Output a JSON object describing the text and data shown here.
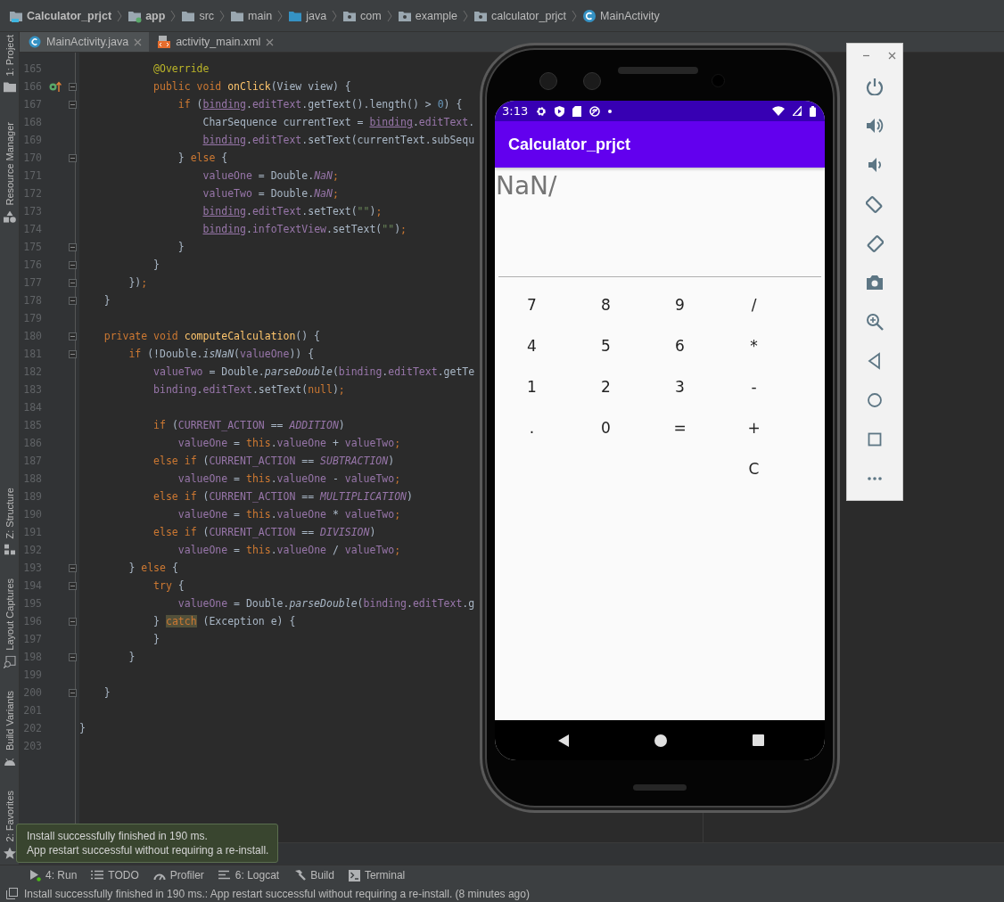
{
  "breadcrumb": [
    {
      "label": "Calculator_prjct",
      "kind": "project"
    },
    {
      "label": "app",
      "kind": "module"
    },
    {
      "label": "src",
      "kind": "folder"
    },
    {
      "label": "main",
      "kind": "folder"
    },
    {
      "label": "java",
      "kind": "source"
    },
    {
      "label": "com",
      "kind": "package"
    },
    {
      "label": "example",
      "kind": "package"
    },
    {
      "label": "calculator_prjct",
      "kind": "package"
    },
    {
      "label": "MainActivity",
      "kind": "class"
    }
  ],
  "tool_strip": {
    "top": [
      {
        "label": "1: Project",
        "kind": "project"
      },
      {
        "label": "Resource Manager",
        "kind": "resource"
      }
    ],
    "bottom": [
      {
        "label": "Z: Structure",
        "kind": "structure"
      },
      {
        "label": "Layout Captures",
        "kind": "captures"
      },
      {
        "label": "Build Variants",
        "kind": "variants"
      },
      {
        "label": "2: Favorites",
        "kind": "favorites"
      }
    ]
  },
  "editor_tabs": [
    {
      "label": "MainActivity.java",
      "kind": "java",
      "selected": true
    },
    {
      "label": "activity_main.xml",
      "kind": "xml",
      "selected": false
    }
  ],
  "editor": {
    "lines": [
      {
        "number": "165",
        "fold": false,
        "override": false,
        "tokens": [
          {
            "kind": "annotation",
            "text": "            @Override"
          }
        ]
      },
      {
        "number": "166",
        "fold": true,
        "override": true,
        "tokens": [
          {
            "kind": "keyword",
            "text": "            public void "
          },
          {
            "kind": "declaration",
            "text": "onClick"
          },
          {
            "kind": "plain",
            "text": "(View view) {"
          }
        ]
      },
      {
        "number": "167",
        "fold": true,
        "override": false,
        "tokens": [
          {
            "kind": "keyword",
            "text": "                if "
          },
          {
            "kind": "plain",
            "text": "("
          },
          {
            "kind": "reference",
            "text": "binding"
          },
          {
            "kind": "plain",
            "text": "."
          },
          {
            "kind": "field",
            "text": "editText"
          },
          {
            "kind": "plain",
            "text": ".getText().length() > "
          },
          {
            "kind": "number",
            "text": "0"
          },
          {
            "kind": "plain",
            "text": ") {"
          }
        ]
      },
      {
        "number": "168",
        "fold": false,
        "override": false,
        "tokens": [
          {
            "kind": "plain",
            "text": "                    CharSequence currentText = "
          },
          {
            "kind": "reference",
            "text": "binding"
          },
          {
            "kind": "plain",
            "text": "."
          },
          {
            "kind": "field",
            "text": "editText"
          },
          {
            "kind": "plain",
            "text": "."
          }
        ]
      },
      {
        "number": "169",
        "fold": false,
        "override": false,
        "tokens": [
          {
            "kind": "reference",
            "text": "                    binding"
          },
          {
            "kind": "plain",
            "text": "."
          },
          {
            "kind": "field",
            "text": "editText"
          },
          {
            "kind": "plain",
            "text": ".setText(currentText.subSequ"
          }
        ]
      },
      {
        "number": "170",
        "fold": true,
        "override": false,
        "tokens": [
          {
            "kind": "plain",
            "text": "                } "
          },
          {
            "kind": "keyword",
            "text": "else "
          },
          {
            "kind": "plain",
            "text": "{"
          }
        ]
      },
      {
        "number": "171",
        "fold": false,
        "override": false,
        "tokens": [
          {
            "kind": "field",
            "text": "                    valueOne"
          },
          {
            "kind": "plain",
            "text": " = Double."
          },
          {
            "kind": "constant",
            "text": "NaN"
          },
          {
            "kind": "keyword",
            "text": ";"
          }
        ]
      },
      {
        "number": "172",
        "fold": false,
        "override": false,
        "tokens": [
          {
            "kind": "field",
            "text": "                    valueTwo"
          },
          {
            "kind": "plain",
            "text": " = Double."
          },
          {
            "kind": "constant",
            "text": "NaN"
          },
          {
            "kind": "keyword",
            "text": ";"
          }
        ]
      },
      {
        "number": "173",
        "fold": false,
        "override": false,
        "tokens": [
          {
            "kind": "reference",
            "text": "                    binding"
          },
          {
            "kind": "plain",
            "text": "."
          },
          {
            "kind": "field",
            "text": "editText"
          },
          {
            "kind": "plain",
            "text": ".setText("
          },
          {
            "kind": "string",
            "text": "\"\""
          },
          {
            "kind": "plain",
            "text": ")"
          },
          {
            "kind": "keyword",
            "text": ";"
          }
        ]
      },
      {
        "number": "174",
        "fold": false,
        "override": false,
        "tokens": [
          {
            "kind": "reference",
            "text": "                    binding"
          },
          {
            "kind": "plain",
            "text": "."
          },
          {
            "kind": "field",
            "text": "infoTextView"
          },
          {
            "kind": "plain",
            "text": ".setText("
          },
          {
            "kind": "string",
            "text": "\"\""
          },
          {
            "kind": "plain",
            "text": ")"
          },
          {
            "kind": "keyword",
            "text": ";"
          }
        ]
      },
      {
        "number": "175",
        "fold": true,
        "override": false,
        "tokens": [
          {
            "kind": "plain",
            "text": "                }"
          }
        ]
      },
      {
        "number": "176",
        "fold": true,
        "override": false,
        "tokens": [
          {
            "kind": "plain",
            "text": "            }"
          }
        ]
      },
      {
        "number": "177",
        "fold": true,
        "override": false,
        "tokens": [
          {
            "kind": "plain",
            "text": "        })"
          },
          {
            "kind": "keyword",
            "text": ";"
          }
        ]
      },
      {
        "number": "178",
        "fold": true,
        "override": false,
        "tokens": [
          {
            "kind": "plain",
            "text": "    }"
          }
        ]
      },
      {
        "number": "179",
        "fold": false,
        "override": false
      },
      {
        "number": "180",
        "fold": true,
        "override": false,
        "tokens": [
          {
            "kind": "keyword",
            "text": "    private void "
          },
          {
            "kind": "declaration",
            "text": "computeCalculation"
          },
          {
            "kind": "plain",
            "text": "() {"
          }
        ]
      },
      {
        "number": "181",
        "fold": true,
        "override": false,
        "tokens": [
          {
            "kind": "keyword",
            "text": "        if "
          },
          {
            "kind": "plain",
            "text": "(!Double."
          },
          {
            "kind": "call",
            "text": "isNaN"
          },
          {
            "kind": "plain",
            "text": "("
          },
          {
            "kind": "field",
            "text": "valueOne"
          },
          {
            "kind": "plain",
            "text": ")) {"
          }
        ]
      },
      {
        "number": "182",
        "fold": false,
        "override": false,
        "tokens": [
          {
            "kind": "field",
            "text": "            valueTwo"
          },
          {
            "kind": "plain",
            "text": " = Double."
          },
          {
            "kind": "call",
            "text": "parseDouble"
          },
          {
            "kind": "plain",
            "text": "("
          },
          {
            "kind": "field",
            "text": "binding"
          },
          {
            "kind": "plain",
            "text": "."
          },
          {
            "kind": "field",
            "text": "editText"
          },
          {
            "kind": "plain",
            "text": ".getTe"
          }
        ]
      },
      {
        "number": "183",
        "fold": false,
        "override": false,
        "tokens": [
          {
            "kind": "field",
            "text": "            binding"
          },
          {
            "kind": "plain",
            "text": "."
          },
          {
            "kind": "field",
            "text": "editText"
          },
          {
            "kind": "plain",
            "text": ".setText("
          },
          {
            "kind": "keyword",
            "text": "null"
          },
          {
            "kind": "plain",
            "text": ")"
          },
          {
            "kind": "keyword",
            "text": ";"
          }
        ]
      },
      {
        "number": "184",
        "fold": false,
        "override": false
      },
      {
        "number": "185",
        "fold": false,
        "override": false,
        "tokens": [
          {
            "kind": "keyword",
            "text": "            if "
          },
          {
            "kind": "plain",
            "text": "("
          },
          {
            "kind": "field",
            "text": "CURRENT_ACTION"
          },
          {
            "kind": "plain",
            "text": " == "
          },
          {
            "kind": "constant",
            "text": "ADDITION"
          },
          {
            "kind": "plain",
            "text": ")"
          }
        ]
      },
      {
        "number": "186",
        "fold": false,
        "override": false,
        "tokens": [
          {
            "kind": "field",
            "text": "                valueOne"
          },
          {
            "kind": "plain",
            "text": " = "
          },
          {
            "kind": "keyword",
            "text": "this"
          },
          {
            "kind": "plain",
            "text": "."
          },
          {
            "kind": "field",
            "text": "valueOne"
          },
          {
            "kind": "plain",
            "text": " + "
          },
          {
            "kind": "field",
            "text": "valueTwo"
          },
          {
            "kind": "keyword",
            "text": ";"
          }
        ]
      },
      {
        "number": "187",
        "fold": false,
        "override": false,
        "tokens": [
          {
            "kind": "keyword",
            "text": "            else if "
          },
          {
            "kind": "plain",
            "text": "("
          },
          {
            "kind": "field",
            "text": "CURRENT_ACTION"
          },
          {
            "kind": "plain",
            "text": " == "
          },
          {
            "kind": "constant",
            "text": "SUBTRACTION"
          },
          {
            "kind": "plain",
            "text": ")"
          }
        ]
      },
      {
        "number": "188",
        "fold": false,
        "override": false,
        "tokens": [
          {
            "kind": "field",
            "text": "                valueOne"
          },
          {
            "kind": "plain",
            "text": " = "
          },
          {
            "kind": "keyword",
            "text": "this"
          },
          {
            "kind": "plain",
            "text": "."
          },
          {
            "kind": "field",
            "text": "valueOne"
          },
          {
            "kind": "plain",
            "text": " - "
          },
          {
            "kind": "field",
            "text": "valueTwo"
          },
          {
            "kind": "keyword",
            "text": ";"
          }
        ]
      },
      {
        "number": "189",
        "fold": false,
        "override": false,
        "tokens": [
          {
            "kind": "keyword",
            "text": "            else if "
          },
          {
            "kind": "plain",
            "text": "("
          },
          {
            "kind": "field",
            "text": "CURRENT_ACTION"
          },
          {
            "kind": "plain",
            "text": " == "
          },
          {
            "kind": "constant",
            "text": "MULTIPLICATION"
          },
          {
            "kind": "plain",
            "text": ")"
          }
        ]
      },
      {
        "number": "190",
        "fold": false,
        "override": false,
        "tokens": [
          {
            "kind": "field",
            "text": "                valueOne"
          },
          {
            "kind": "plain",
            "text": " = "
          },
          {
            "kind": "keyword",
            "text": "this"
          },
          {
            "kind": "plain",
            "text": "."
          },
          {
            "kind": "field",
            "text": "valueOne"
          },
          {
            "kind": "plain",
            "text": " * "
          },
          {
            "kind": "field",
            "text": "valueTwo"
          },
          {
            "kind": "keyword",
            "text": ";"
          }
        ]
      },
      {
        "number": "191",
        "fold": false,
        "override": false,
        "tokens": [
          {
            "kind": "keyword",
            "text": "            else if "
          },
          {
            "kind": "plain",
            "text": "("
          },
          {
            "kind": "field",
            "text": "CURRENT_ACTION"
          },
          {
            "kind": "plain",
            "text": " == "
          },
          {
            "kind": "constant",
            "text": "DIVISION"
          },
          {
            "kind": "plain",
            "text": ")"
          }
        ]
      },
      {
        "number": "192",
        "fold": false,
        "override": false,
        "tokens": [
          {
            "kind": "field",
            "text": "                valueOne"
          },
          {
            "kind": "plain",
            "text": " = "
          },
          {
            "kind": "keyword",
            "text": "this"
          },
          {
            "kind": "plain",
            "text": "."
          },
          {
            "kind": "field",
            "text": "valueOne"
          },
          {
            "kind": "plain",
            "text": " / "
          },
          {
            "kind": "field",
            "text": "valueTwo"
          },
          {
            "kind": "keyword",
            "text": ";"
          }
        ]
      },
      {
        "number": "193",
        "fold": true,
        "override": false,
        "tokens": [
          {
            "kind": "plain",
            "text": "        } "
          },
          {
            "kind": "keyword",
            "text": "else "
          },
          {
            "kind": "plain",
            "text": "{"
          }
        ]
      },
      {
        "number": "194",
        "fold": true,
        "override": false,
        "tokens": [
          {
            "kind": "keyword",
            "text": "            try "
          },
          {
            "kind": "plain",
            "text": "{"
          }
        ]
      },
      {
        "number": "195",
        "fold": false,
        "override": false,
        "tokens": [
          {
            "kind": "field",
            "text": "                valueOne"
          },
          {
            "kind": "plain",
            "text": " = Double."
          },
          {
            "kind": "call",
            "text": "parseDouble"
          },
          {
            "kind": "plain",
            "text": "("
          },
          {
            "kind": "field",
            "text": "binding"
          },
          {
            "kind": "plain",
            "text": "."
          },
          {
            "kind": "field",
            "text": "editText"
          },
          {
            "kind": "plain",
            "text": ".g"
          }
        ]
      },
      {
        "number": "196",
        "fold": true,
        "override": false,
        "tokens": [
          {
            "kind": "plain",
            "text": "            } "
          },
          {
            "kind": "highlight",
            "text": "catch"
          },
          {
            "kind": "plain",
            "text": " (Exception e) {"
          }
        ]
      },
      {
        "number": "197",
        "fold": false,
        "override": false,
        "tokens": [
          {
            "kind": "plain",
            "text": "            }"
          }
        ]
      },
      {
        "number": "198",
        "fold": true,
        "override": false,
        "tokens": [
          {
            "kind": "plain",
            "text": "        }"
          }
        ]
      },
      {
        "number": "199",
        "fold": false,
        "override": false
      },
      {
        "number": "200",
        "fold": true,
        "override": false,
        "tokens": [
          {
            "kind": "plain",
            "text": "    }"
          }
        ]
      },
      {
        "number": "201",
        "fold": false,
        "override": false
      },
      {
        "number": "202",
        "fold": false,
        "override": false,
        "tokens": [
          {
            "kind": "plain",
            "text": "}"
          }
        ]
      },
      {
        "number": "203",
        "fold": false,
        "override": false
      }
    ]
  },
  "emulator": {
    "time": "3:13",
    "app_title": "Calculator_prjct",
    "display": "NaN/",
    "keypad": [
      [
        "7",
        "8",
        "9",
        "/"
      ],
      [
        "4",
        "5",
        "6",
        "*"
      ],
      [
        "1",
        "2",
        "3",
        "-"
      ],
      [
        ".",
        "0",
        "=",
        "+"
      ],
      [
        "C"
      ]
    ]
  },
  "notification": {
    "lines": [
      "Install successfully finished in 190 ms.",
      "App restart successful without requiring a re-install."
    ]
  },
  "tool_windows": [
    {
      "label": "4: Run",
      "kind": "run"
    },
    {
      "label": "TODO",
      "kind": "todo"
    },
    {
      "label": "Profiler",
      "kind": "profiler"
    },
    {
      "label": "6: Logcat",
      "kind": "logcat"
    },
    {
      "label": "Build",
      "kind": "build"
    },
    {
      "label": "Terminal",
      "kind": "terminal"
    }
  ],
  "status_bar": {
    "message": "Install successfully finished in 190 ms.: App restart successful without requiring a re-install. (8 minutes ago)"
  }
}
